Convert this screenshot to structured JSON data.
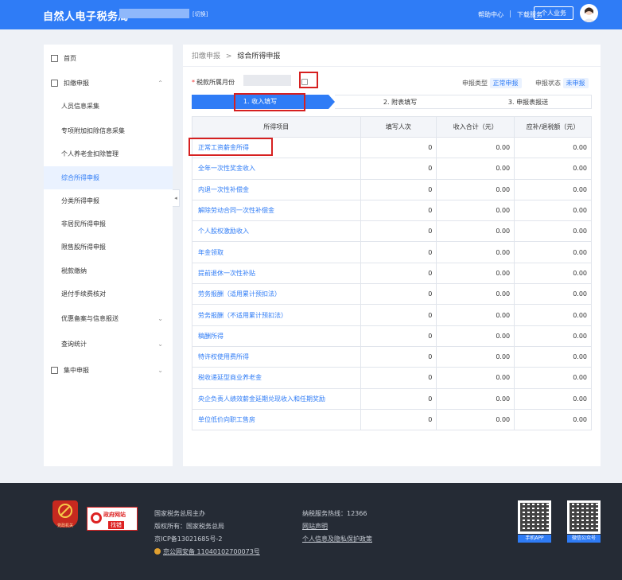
{
  "header": {
    "brand": "自然人电子税务局",
    "switch_label": "[切换]",
    "help_center": "帮助中心",
    "download_service": "下载服务",
    "personal_business": "个人业务"
  },
  "sidebar": {
    "home": "首页",
    "withholding": "扣缴申报",
    "sub_items": [
      "人员信息采集",
      "专项附加扣除信息采集",
      "个人养老金扣除管理",
      "综合所得申报",
      "分类所得申报",
      "非居民所得申报",
      "限售股所得申报",
      "税款缴纳",
      "退付手续费核对",
      "优惠备案与信息报送",
      "查询统计"
    ],
    "group_declare": "集中申报",
    "collapse_arrow": "◂"
  },
  "main": {
    "breadcrumb_parent": "扣缴申报",
    "breadcrumb_sep": ">",
    "breadcrumb_current": "综合所得申报",
    "period_required": "*",
    "period_label": "税款所属月份",
    "report_type_label": "申报类型",
    "report_type_value": "正常申报",
    "report_status_label": "申报状态",
    "report_status_value": "未申报",
    "steps": [
      "1. 收入填写",
      "2. 附表填写",
      "3. 申报表报送"
    ],
    "table": {
      "headers": [
        "所得项目",
        "填写人次",
        "收入合计（元）",
        "应补/退税额（元）"
      ],
      "rows": [
        [
          "正常工资薪金所得",
          "0",
          "0.00",
          "0.00"
        ],
        [
          "全年一次性奖金收入",
          "0",
          "0.00",
          "0.00"
        ],
        [
          "内退一次性补偿金",
          "0",
          "0.00",
          "0.00"
        ],
        [
          "解除劳动合同一次性补偿金",
          "0",
          "0.00",
          "0.00"
        ],
        [
          "个人股权激励收入",
          "0",
          "0.00",
          "0.00"
        ],
        [
          "年金领取",
          "0",
          "0.00",
          "0.00"
        ],
        [
          "提前退休一次性补贴",
          "0",
          "0.00",
          "0.00"
        ],
        [
          "劳务报酬（适用累计预扣法）",
          "0",
          "0.00",
          "0.00"
        ],
        [
          "劳务报酬（不适用累计预扣法）",
          "0",
          "0.00",
          "0.00"
        ],
        [
          "稿酬所得",
          "0",
          "0.00",
          "0.00"
        ],
        [
          "特许权使用费所得",
          "0",
          "0.00",
          "0.00"
        ],
        [
          "税收递延型商业养老金",
          "0",
          "0.00",
          "0.00"
        ],
        [
          "央企负责人绩效薪金延期兑现收入和任期奖励",
          "0",
          "0.00",
          "0.00"
        ],
        [
          "单位低价向职工售房",
          "0",
          "0.00",
          "0.00"
        ]
      ]
    }
  },
  "footer": {
    "emblem_text": "党政机关",
    "gov_site_line1": "政府网站",
    "gov_site_line2": "找错",
    "host": "国家税务总局主办",
    "copyright": "版权所有：国家税务总局",
    "icp": "京ICP备13021685号-2",
    "police": "京公网安备 11040102700073号",
    "hotline": "纳税服务热线：12366",
    "site_statement": "网站声明",
    "privacy": "个人信息及隐私保护政策",
    "qr_app": "手机APP",
    "qr_wechat": "微信公众号"
  },
  "colors": {
    "primary": "#2f7cf6",
    "highlight": "#d62020",
    "footer_bg": "#252b35"
  }
}
